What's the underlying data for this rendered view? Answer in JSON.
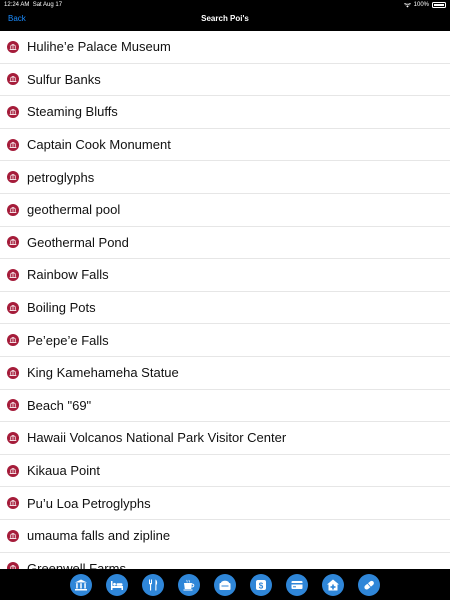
{
  "status": {
    "time": "12:24 AM",
    "date": "Sat Aug 17",
    "battery": "100%"
  },
  "nav": {
    "back_label": "Back",
    "title": "Search Poi's"
  },
  "pois": [
    "Hulihe’e Palace Museum",
    "Sulfur Banks",
    "Steaming Bluffs",
    "Captain Cook Monument",
    "petroglyphs",
    "geothermal pool",
    "Geothermal Pond",
    "Rainbow Falls",
    "Boiling Pots",
    "Pe’epe’e Falls",
    "King Kamehameha Statue",
    "Beach \"69\"",
    "Hawaii Volcanos National Park Visitor Center",
    "Kikaua Point",
    "Pu’u Loa Petroglyphs",
    "umauma falls and zipline",
    "Greenwell Farms"
  ],
  "tabs": [
    {
      "icon": "museum-icon"
    },
    {
      "icon": "bed-icon"
    },
    {
      "icon": "fork-knife-icon"
    },
    {
      "icon": "coffee-icon"
    },
    {
      "icon": "food-plate-icon"
    },
    {
      "icon": "dollar-icon"
    },
    {
      "icon": "credit-card-icon"
    },
    {
      "icon": "hospital-icon"
    },
    {
      "icon": "pill-icon"
    }
  ],
  "colors": {
    "accent": "#1a8cff",
    "poi_icon": "#a51c3a",
    "tab_icon": "#2f86d8"
  }
}
